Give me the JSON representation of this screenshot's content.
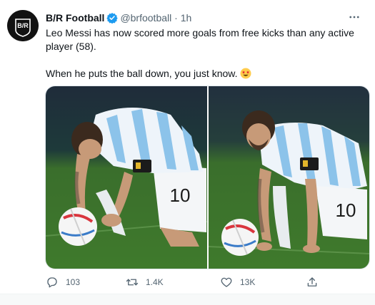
{
  "tweet": {
    "author_name": "B/R Football",
    "handle": "@brfootball",
    "separator": "·",
    "time": "1h",
    "avatar_text": "B/R",
    "text_line1": "Leo Messi has now scored more goals from free kicks than any active player (58).",
    "text_line2": "When he puts the ball down, you just know.",
    "emoji": "star-struck-emoji",
    "jersey_number": "10"
  },
  "actions": {
    "reply_count": "103",
    "retweet_count": "1.4K",
    "like_count": "13K"
  },
  "icons": {
    "verified": "verified-badge-icon",
    "more": "more-options-icon",
    "reply": "reply-icon",
    "retweet": "retweet-icon",
    "like": "like-icon",
    "share": "share-icon"
  },
  "colors": {
    "verified_blue": "#1d9bf0",
    "secondary_text": "#536471",
    "pitch_green": "#3f7a2c",
    "jersey_light_blue": "#8cc3ea"
  }
}
